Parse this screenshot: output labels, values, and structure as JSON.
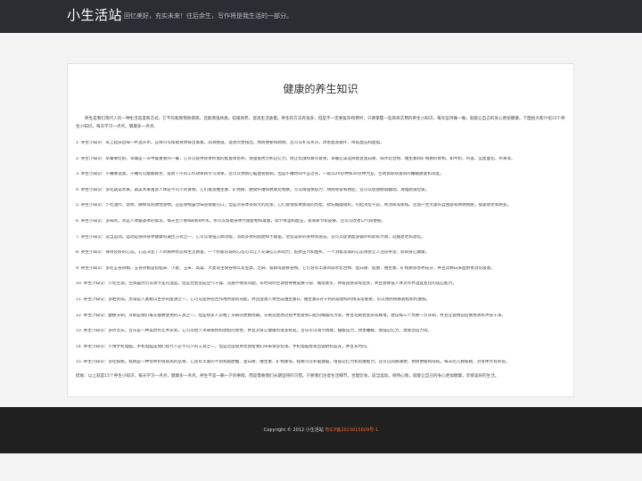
{
  "header": {
    "site_title": "小生活站",
    "tagline": "回忆美好，充实未来！往后余生，写作将是我生活的一部分。"
  },
  "article": {
    "title": "健康的养生知识",
    "intro": "养生是我们现代人的一种生活态度和方式，它不仅能够预防疾病，还能增强体质，延缓衰老，提高生活质量。养生的方法有很多，但是不一定要复杂和费时，只要掌握一些简单实用的养生小知识，每天坚持做一做，就能让自己的身心更加健康。下面给大家介绍15个养生小知识，每天学习一点点，健康多一点点。",
    "tips": [
      "1. 养生小知识：早上起床后喝一杯温开水。这样可以帮助身体排出毒素，润滑肠道，促进大便排出，预防便秘和肠癌。还可以补充水分，改善血液循环，降低血压和血脂。",
      "2. 养生小知识：早餐要吃好。早餐是一天中最重要的一餐，它可以提供身体所需的能量和营养，增强抵抗力和记忆力，防止饥饿和暴饮暴食。早餐应该选择富含蛋白质、碳水化合物、维生素和矿物质的食物，如牛奶、鸡蛋、全麦面包、水果等。",
      "3. 养生小知识：午睡要适量。午睡可以缓解疲劳，提高下午的工作效率和学习效果，还可以预防心脑血管疾病。但是午睡时间不宜过长，一般以20分钟到30分钟为宜，否则会影响夜间的睡眠质量和深度。",
      "4. 养生小知识：多吃蔬菜水果。蔬菜水果富含人体必不可少的食物，它们富含维生素、矿物质、膳食纤维和抗氧化物质，可以增强免疫力，预防感冒和癌症，还可以促进肠道蠕动，清理肠道垃圾。",
      "5. 养生小知识：少吃油炸、烧烤、腌制等刺激性食物。这些食物虽然味道香脆可口，但是对身体有很大的危害。它们会增加胃肠道的负担，损伤黏膜组织，引起消化不良、胃溃疡等疾病。还会产生大量的自由基和致癌物质，加速衰老和癌变。",
      "6. 养生小知识：多喝水。水是人体最基本的需求，每天至少要喝8到8杯水。水可以帮助身体代谢废物和毒素，调节体温和血压，润滑关节和皮肤，还可以改善口气和便秘。",
      "7. 养生小知识：适当运动。运动是保持身体健康的最佳方式之一，它可以增强心肺功能，消耗多余的脂肪和卡路里，塑造美好的身材和姿态。还可以促进血液循环和新陈代谢，延缓衰老和退化。",
      "8. 养生小知识：保持良好的心态。心态决定了人的精神状态和生活质量。一个积极乐观的心态可以让人充满信心和动力，抵抗压力和挫折。一个消极悲观的心态则会让人沮丧失望，影响身心健康。",
      "9. 养生小知识：多吃五谷杂粮。五谷杂粮是指稻米、小麦、玉米、高粱、大麦等主食谷物以及豆类、芝麻、核桃等副食谷物。它们含有丰富的碳水化合物、蛋白质、脂肪、维生素、矿物质等营养成分，并且比精白米面更易消化吸收。",
      "10. 养生小知识：少吃空调。空调虽然可以调节室内温度，但是也会造成空气干燥、流通不畅等问题。长时间吹空调会导致皮肤干裂、喉咙发炎、呼吸道感染等症状，并且会降低人体对外界温度变化的适应能力。",
      "11. 养生小知识：多晒太阳。太阳是人类赖以生存的能源之一，它可以提供光合作用所需的光能，并且促进人体合成维生素D。维生素D对于钙的吸收和利用非常重要，可以预防骨质疏松和佝偻病。",
      "12. 养生小知识：勤换牙刷。牙刷是我们每天都要使用的工具之一，但是很多人忽略了牙刷的更换周期。牙刷在使用过程中会受到口腔内细菌的污染，并且毛刷会变形或掉落。建议每三个月换一次牙刷，并且在使用前后要用清水冲洗干净。",
      "13. 养生小知识：多听音乐。音乐是一种美妙的艺术形式，它可以给人带来愉悦和放松的感觉，并且对身心健康有很多好处。音乐可以调节情绪，缓解压力，改善睡眠，增强记忆力，激发创造力等。",
      "14. 养生小知识：少用手机电脑。手机电脑是我们现代人必不可少的工具之一，但是过度使用也会给我们带来很多危害。手机电脑会发出辐射和蓝光，并且长时间。",
      "15. 养生小知识：多吃核桃。核桃是一种营养价值很高的坚果，它含有丰富的不饱和脂肪酸、蛋白质、维生素、矿物质等。核桃可以补脑健脑，增强记忆力和思维能力，还可以润肠通便，预防便秘和痔疮。每天吃几颗核桃，对身体大有好处。"
    ],
    "conclusion": "结尾：以上就是15个养生小知识，每天学习一点点，健康多一点点。养生不是一朝一夕的事情，而是需要我们长期坚持的习惯。只要我们注意生活细节，合理饮食，适当运动，保持心情，就能让自己的身心更加健康，享受美好的生活。"
  },
  "footer": {
    "copyright": "Copyright © 2012 小生活站",
    "icp": "粤ICP备2023015609号-1"
  },
  "colors": {
    "header_bg": "#2b2d33",
    "footer_bg": "#202020",
    "page_bg": "#f4f4f4",
    "icp_link": "#e8632a"
  }
}
